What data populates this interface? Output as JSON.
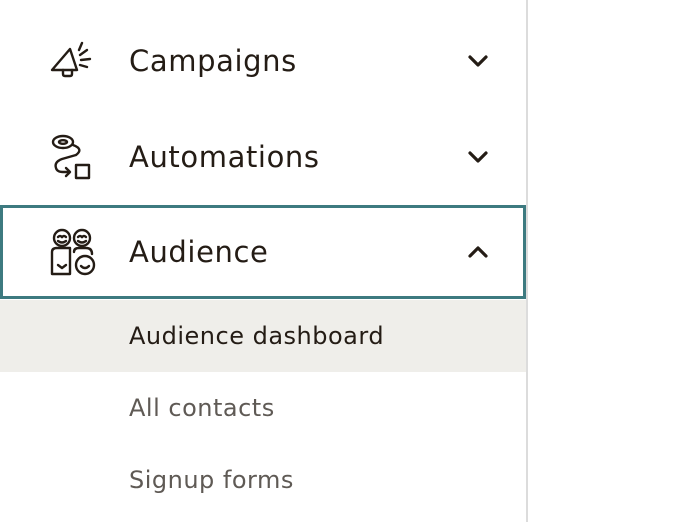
{
  "nav": {
    "items": [
      {
        "label": "Campaigns",
        "icon": "megaphone-icon",
        "state": "collapsed",
        "chevron": "chevron-down-icon"
      },
      {
        "label": "Automations",
        "icon": "automation-flow-icon",
        "state": "collapsed",
        "chevron": "chevron-down-icon"
      },
      {
        "label": "Audience",
        "icon": "audience-people-icon",
        "state": "expanded",
        "chevron": "chevron-up-icon"
      }
    ],
    "audience_submenu": [
      {
        "label": "Audience dashboard",
        "selected": true
      },
      {
        "label": "All contacts",
        "selected": false
      },
      {
        "label": "Signup forms",
        "selected": false
      }
    ]
  },
  "colors": {
    "text_primary": "#241c15",
    "text_secondary": "#5f5a55",
    "focus_border": "#3d7a80",
    "selected_bg": "#efeeea",
    "divider": "#dcdcdc"
  }
}
